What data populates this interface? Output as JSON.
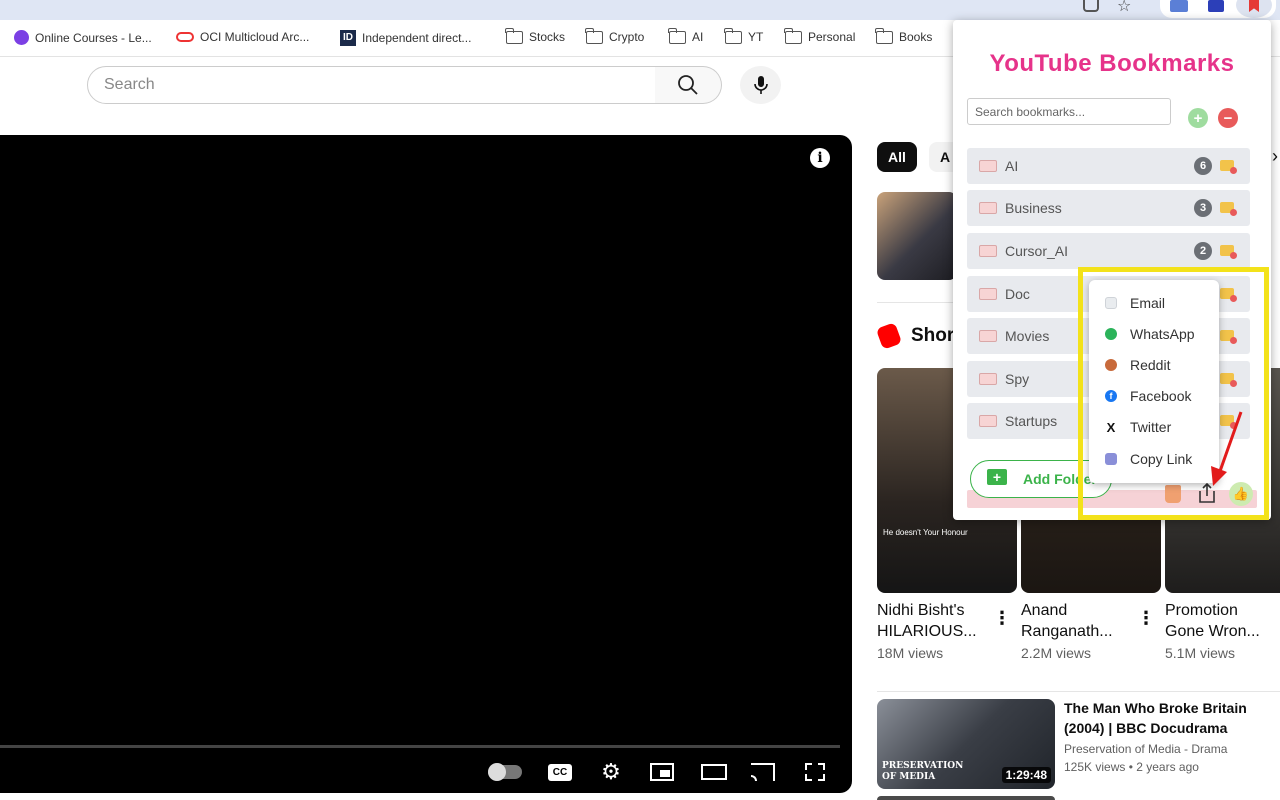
{
  "bookmarks_bar": {
    "items": [
      {
        "label": "Online Courses - Le...",
        "icon": "online-courses-icon"
      },
      {
        "label": "OCI Multicloud Arc...",
        "icon": "oracle-icon"
      },
      {
        "label": "Independent direct...",
        "icon": "id-icon"
      },
      {
        "label": "Stocks",
        "icon": "folder-icon"
      },
      {
        "label": "Crypto",
        "icon": "folder-icon"
      },
      {
        "label": "AI",
        "icon": "folder-icon"
      },
      {
        "label": "YT",
        "icon": "folder-icon"
      },
      {
        "label": "Personal",
        "icon": "folder-icon"
      },
      {
        "label": "Books",
        "icon": "folder-icon"
      }
    ]
  },
  "youtube": {
    "search_placeholder": "Search",
    "chips": [
      "All",
      "A"
    ],
    "shorts_heading": "Shor",
    "shorts": [
      {
        "title_line1": "Nidhi Bisht's",
        "title_line2": "HILARIOUS...",
        "views": "18M views",
        "caption": "He doesn't Your Honour"
      },
      {
        "title_line1": "Anand",
        "title_line2": "Ranganath...",
        "views": "2.2M views",
        "caption": ""
      },
      {
        "title_line1": "Promotion",
        "title_line2": "Gone Wron...",
        "views": "5.1M views",
        "caption": ""
      }
    ],
    "video": {
      "title": "The Man Who Broke Britain (2004) | BBC Docudrama",
      "channel": "Preservation of Media - Drama",
      "stats": "125K views • 2 years ago",
      "duration": "1:29:48",
      "thumb_caption": "PRESERVATION OF MEDIA"
    }
  },
  "extension": {
    "title": "YouTube Bookmarks",
    "search_placeholder": "Search bookmarks...",
    "folders": [
      {
        "name": "AI",
        "count": "6"
      },
      {
        "name": "Business",
        "count": "3"
      },
      {
        "name": "Cursor_AI",
        "count": "2"
      },
      {
        "name": "Doc",
        "count": ""
      },
      {
        "name": "Movies",
        "count": ""
      },
      {
        "name": "Spy",
        "count": ""
      },
      {
        "name": "Startups",
        "count": ""
      }
    ],
    "add_folder_label": "Add Folder",
    "share_menu": [
      {
        "label": "Email",
        "icon": "email-icon",
        "color": "#cfd3d8"
      },
      {
        "label": "WhatsApp",
        "icon": "whatsapp-icon",
        "color": "#2bb35a"
      },
      {
        "label": "Reddit",
        "icon": "reddit-icon",
        "color": "#c86a3b"
      },
      {
        "label": "Facebook",
        "icon": "facebook-icon",
        "color": "#1877f2"
      },
      {
        "label": "Twitter",
        "icon": "twitter-x-icon",
        "color": "#111111"
      },
      {
        "label": "Copy Link",
        "icon": "link-icon",
        "color": "#8a8fd8"
      }
    ],
    "colors": {
      "title": "#e6338a",
      "add": "#3bb34a",
      "remove": "#e85a5a",
      "highlight": "#f3e21a"
    }
  }
}
